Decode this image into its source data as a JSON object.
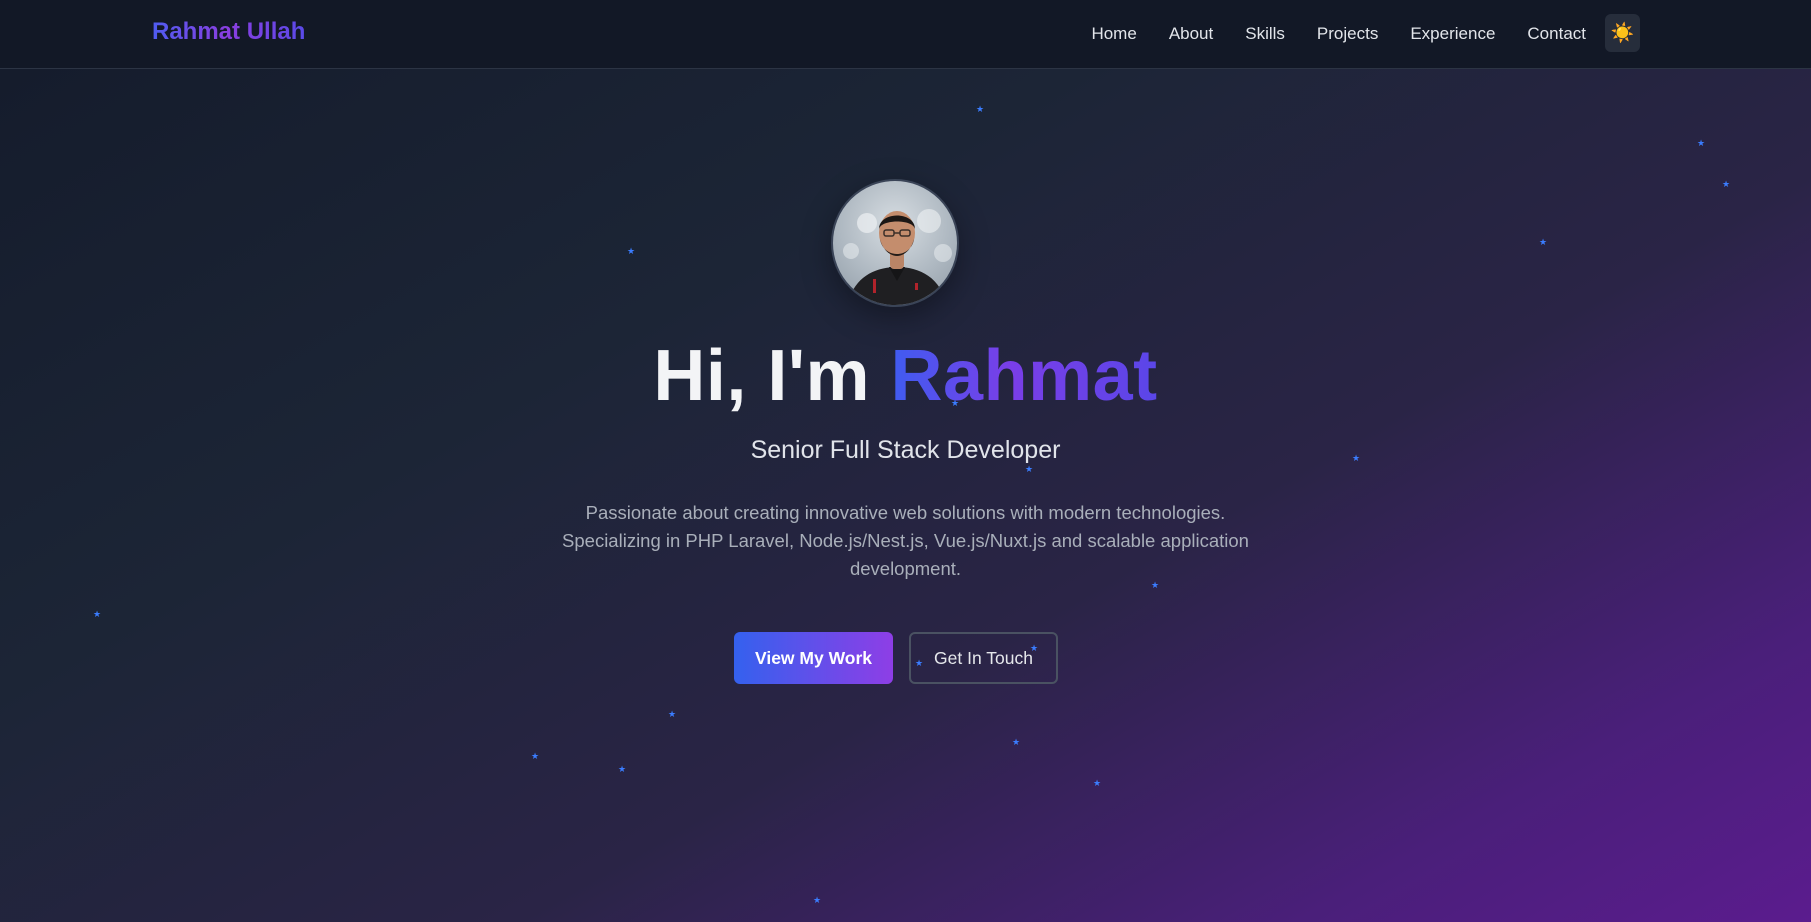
{
  "navbar": {
    "brand": "Rahmat Ullah",
    "links": [
      "Home",
      "About",
      "Skills",
      "Projects",
      "Experience",
      "Contact"
    ],
    "theme_toggle_icon": "sun-icon",
    "theme_toggle_glyph": "☀️"
  },
  "hero": {
    "greeting": "Hi, I'm ",
    "name": "Rahmat",
    "subtitle": "Senior Full Stack Developer",
    "description": "Passionate about creating innovative web solutions with modern technologies. Specializing in PHP Laravel, Node.js/Nest.js, Vue.js/Nuxt.js and scalable application development.",
    "primary_button": "View My Work",
    "secondary_button": "Get In Touch",
    "star_glyph": "★"
  },
  "colors": {
    "accent_start": "#3461ee",
    "accent_end": "#8e3ee6",
    "star": "#3b7dff",
    "navbar_bg": "#121826"
  }
}
